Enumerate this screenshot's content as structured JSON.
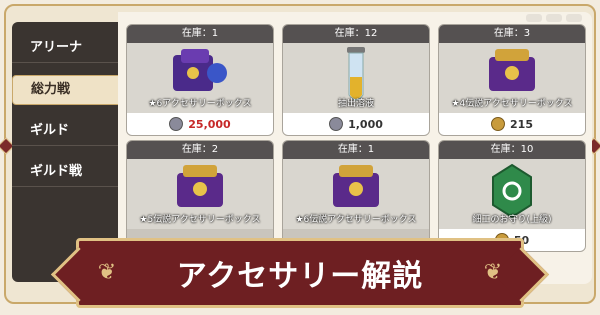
{
  "tabs": [
    {
      "label": "アリーナ"
    },
    {
      "label": "総力戦",
      "active": true
    },
    {
      "label": "ギルド"
    },
    {
      "label": "ギルド戦"
    }
  ],
  "cards": [
    {
      "stock": "在庫：1",
      "name": "★6アクセサリーボックス",
      "price": "25,000",
      "coin": "silver",
      "price_color": "red",
      "art_icon": "purple-accessory-box-icon"
    },
    {
      "stock": "在庫：12",
      "name": "抽出溶液",
      "price": "1,000",
      "coin": "silver",
      "price_color": "dark",
      "art_icon": "vial-icon"
    },
    {
      "stock": "在庫：3",
      "name": "★4伝説アクセサリーボックス",
      "price": "215",
      "coin": "gold",
      "price_color": "dark",
      "art_icon": "gold-accessory-box-icon"
    },
    {
      "stock": "在庫：2",
      "name": "★5伝説アクセサリーボックス",
      "price": "",
      "coin": "gold",
      "price_color": "dark",
      "art_icon": "gold-accessory-box-icon"
    },
    {
      "stock": "在庫：1",
      "name": "★6伝説アクセサリーボックス",
      "price": "",
      "coin": "gold",
      "price_color": "dark",
      "art_icon": "gold-accessory-box-icon"
    },
    {
      "stock": "在庫：10",
      "name": "細工のお守り(上級)",
      "price": "50",
      "coin": "gold",
      "price_color": "dark",
      "art_icon": "green-amulet-icon"
    }
  ],
  "banner": {
    "title": "アクセサリー解説"
  },
  "colors": {
    "accent": "#6e1f22",
    "gold": "#e0c184",
    "sidebar": "#3a3430"
  }
}
